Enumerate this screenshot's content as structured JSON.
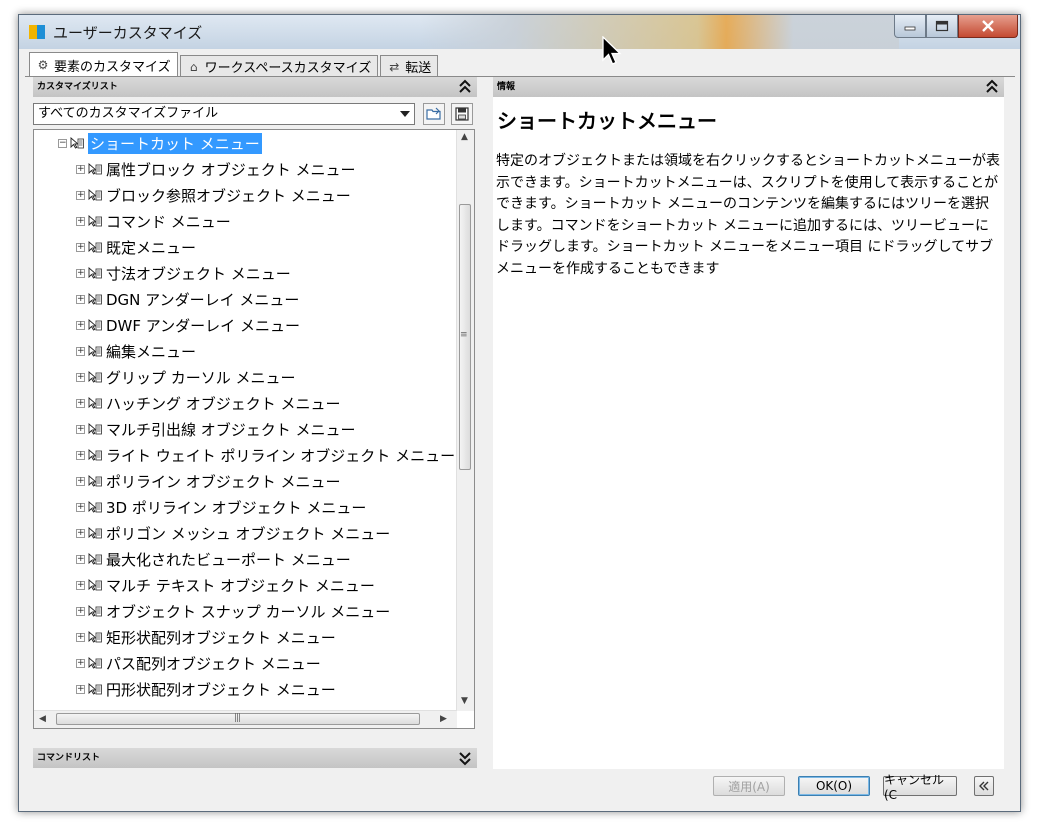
{
  "window": {
    "title": "ユーザーカスタマイズ"
  },
  "tabs": [
    {
      "label": "要素のカスタマイズ",
      "icon": "gear-icon",
      "active": true
    },
    {
      "label": "ワークスペースカスタマイズ",
      "icon": "home-icon",
      "active": false
    },
    {
      "label": "転送",
      "icon": "transfer-icon",
      "active": false
    }
  ],
  "customize_list": {
    "header": "カスタマイズリスト",
    "dropdown_value": "すべてのカスタマイズファイル",
    "tree_root": "ショートカット メニュー",
    "tree_items": [
      "属性ブロック オブジェクト メニュー",
      "ブロック参照オブジェクト メニュー",
      "コマンド メニュー",
      "既定メニュー",
      "寸法オブジェクト メニュー",
      "DGN アンダーレイ メニュー",
      "DWF アンダーレイ メニュー",
      "編集メニュー",
      "グリップ カーソル メニュー",
      "ハッチング オブジェクト メニュー",
      "マルチ引出線 オブジェクト メニュー",
      "ライト ウェイト ポリライン オブジェクト メニュー",
      "ポリライン オブジェクト メニュー",
      "3D ポリライン オブジェクト メニュー",
      "ポリゴン メッシュ オブジェクト メニュー",
      "最大化されたビューポート メニュー",
      "マルチ テキスト オブジェクト メニュー",
      "オブジェクト スナップ カーソル メニュー",
      "矩形状配列オブジェクト メニュー",
      "パス配列オブジェクト メニュー",
      "円形状配列オブジェクト メニュー"
    ]
  },
  "command_list": {
    "header": "コマンドリスト"
  },
  "info_panel": {
    "header": "情報",
    "title": "ショートカットメニュー",
    "body": "特定のオブジェクトまたは領域を右クリックするとショートカットメニューが表示できます。ショートカットメニューは、スクリプトを使用して表示することができます。ショートカット メニューのコンテンツを編集するにはツリーを選択します。コマンドをショートカット メニューに追加するには、ツリービューにドラッグします。ショートカット メニューをメニュー項目 にドラッグしてサブメニューを作成することもできます"
  },
  "buttons": {
    "apply": "適用(A)",
    "ok": "OK(O)",
    "cancel": "キャンセル(C"
  },
  "colors": {
    "selection": "#3399ff",
    "close_button": "#c44a32"
  }
}
